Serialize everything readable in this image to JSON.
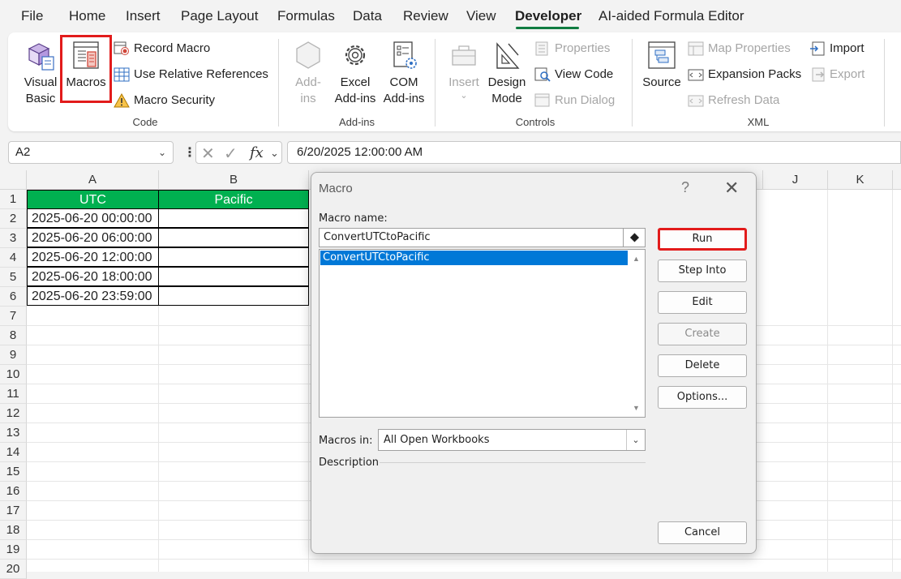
{
  "menu": {
    "tabs": [
      "File",
      "Home",
      "Insert",
      "Page Layout",
      "Formulas",
      "Data",
      "Review",
      "View",
      "Developer",
      "AI-aided Formula Editor"
    ],
    "active_tab": "Developer"
  },
  "ribbon": {
    "code": {
      "visual_basic": "Visual\nBasic",
      "visual_basic_l1": "Visual",
      "visual_basic_l2": "Basic",
      "macros": "Macros",
      "record_macro": "Record Macro",
      "use_relative": "Use Relative References",
      "macro_security": "Macro Security",
      "label": "Code"
    },
    "addins": {
      "addins_l1": "Add-",
      "addins_l2": "ins",
      "excel_l1": "Excel",
      "excel_l2": "Add-ins",
      "com_l1": "COM",
      "com_l2": "Add-ins",
      "label": "Add-ins"
    },
    "controls": {
      "insert": "Insert",
      "design_l1": "Design",
      "design_l2": "Mode",
      "properties": "Properties",
      "view_code": "View Code",
      "run_dialog": "Run Dialog",
      "label": "Controls"
    },
    "xml": {
      "source": "Source",
      "map_properties": "Map Properties",
      "expansion_packs": "Expansion Packs",
      "refresh_data": "Refresh Data",
      "import": "Import",
      "export": "Export",
      "label": "XML"
    }
  },
  "formula_bar": {
    "name_box": "A2",
    "fx": "fx",
    "formula": "6/20/2025  12:00:00 AM"
  },
  "sheet": {
    "columns": [
      "A",
      "B",
      "J",
      "K"
    ],
    "rows": [
      "1",
      "2",
      "3",
      "4",
      "5",
      "6",
      "7",
      "8",
      "9",
      "10",
      "11",
      "12",
      "13",
      "14",
      "15",
      "16",
      "17",
      "18",
      "19",
      "20"
    ],
    "header": [
      "UTC",
      "Pacific"
    ],
    "utc_values": [
      "2025-06-20 00:00:00",
      "2025-06-20 06:00:00",
      "2025-06-20 12:00:00",
      "2025-06-20 18:00:00",
      "2025-06-20 23:59:00"
    ]
  },
  "dialog": {
    "title": "Macro",
    "help": "?",
    "macro_name_label": "Macro name:",
    "macro_name_value": "ConvertUTCtoPacific",
    "list_items": [
      "ConvertUTCtoPacific"
    ],
    "buttons": {
      "run": "Run",
      "step_into": "Step Into",
      "edit": "Edit",
      "create": "Create",
      "delete": "Delete",
      "options": "Options...",
      "cancel": "Cancel"
    },
    "macros_in_label": "Macros in:",
    "macros_in_value": "All Open Workbooks",
    "description_label": "Description"
  },
  "colors": {
    "accent": "#107c41",
    "header_fill": "#00b050",
    "highlight_box": "#e21b1b",
    "selection": "#0078d7"
  }
}
